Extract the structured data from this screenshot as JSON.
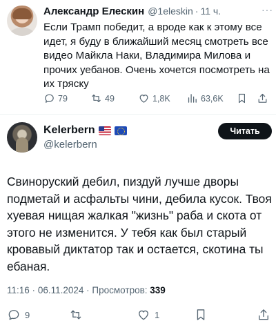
{
  "parent_tweet": {
    "author_name": "Александр Елескин",
    "handle": "@1eleskin",
    "dot": "·",
    "time": "11 ч.",
    "more": "···",
    "text": "Если Трамп победит, а вроде как к этому все идет, я буду в ближайший месяц смотреть все видео Майкла Наки, Владимира Милова и прочих уебанов. Очень хочется посмотреть на их тряску",
    "stats": {
      "replies": "79",
      "reposts": "49",
      "likes": "1,8K",
      "views": "63,6K"
    }
  },
  "main_tweet": {
    "author_name": "Kelerbern",
    "handle": "@kelerbern",
    "flags": [
      "us-flag",
      "eu-flag"
    ],
    "follow_label": "Читать",
    "text": "Свиноруский дебил, пиздуй лучше дворы подметай и асфальты чини, дебила кусок. Твоя хуевая нищая жалкая \"жизнь\" раба и скота от этого не изменится. У тебя как был старый кровавый диктатор так и остается, скотина ты ебаная.",
    "meta": {
      "time": "11:16",
      "date": "06.11.2024",
      "views_label": "Просмотров:",
      "views_count": "339",
      "separator": "·"
    },
    "stats": {
      "replies": "9",
      "reposts": "",
      "likes": "1"
    }
  },
  "colors": {
    "text": "#0f1419",
    "secondary": "#536471",
    "divider": "#eff3f4",
    "button": "#0f1419"
  }
}
